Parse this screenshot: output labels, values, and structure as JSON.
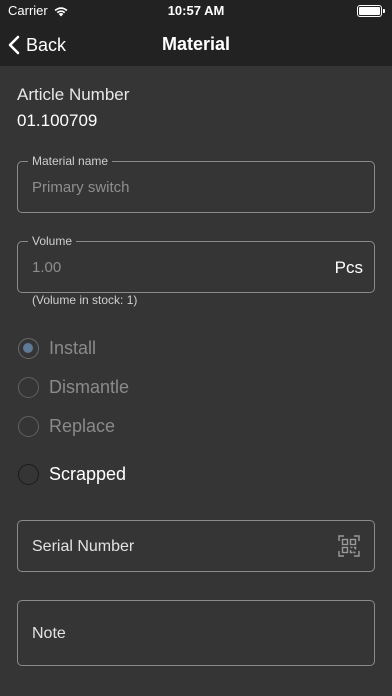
{
  "status_bar": {
    "carrier": "Carrier",
    "time": "10:57 AM"
  },
  "nav": {
    "back_label": "Back",
    "title": "Material"
  },
  "article": {
    "label": "Article Number",
    "value": "01.100709"
  },
  "material_name": {
    "legend": "Material name",
    "value": "Primary switch"
  },
  "volume": {
    "legend": "Volume",
    "value": "1.00",
    "unit": "Pcs",
    "hint": "(Volume in stock: 1)"
  },
  "actions": [
    {
      "label": "Install",
      "checked": true
    },
    {
      "label": "Dismantle",
      "checked": false
    },
    {
      "label": "Replace",
      "checked": false
    }
  ],
  "scrapped": {
    "label": "Scrapped",
    "checked": false
  },
  "serial_number": {
    "placeholder": "Serial Number"
  },
  "note": {
    "placeholder": "Note"
  }
}
